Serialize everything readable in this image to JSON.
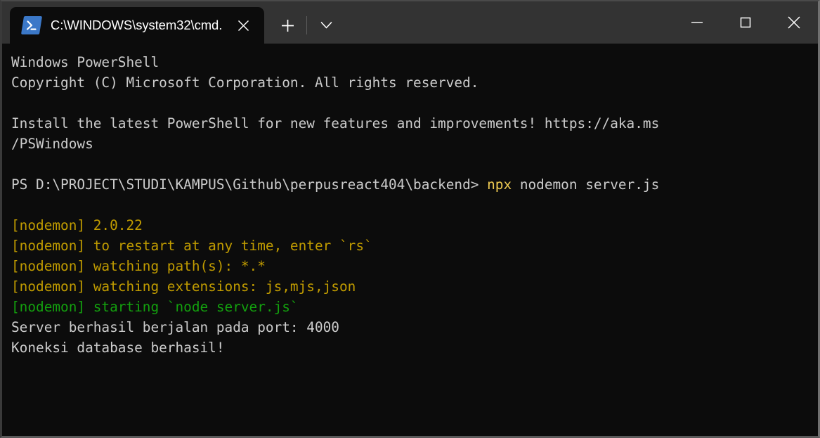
{
  "window": {
    "tab": {
      "title": "C:\\WINDOWS\\system32\\cmd.",
      "icon": "powershell-icon",
      "close_label": "✕"
    },
    "toolbar": {
      "new_tab_label": "+",
      "dropdown_label": "⌄"
    },
    "controls": {
      "minimize_label": "—",
      "maximize_label": "□",
      "close_label": "✕"
    }
  },
  "terminal": {
    "colors": {
      "background": "#0c0c0c",
      "foreground": "#cccccc",
      "yellow": "#c19c00",
      "bright_yellow": "#eeca52",
      "green": "#13a10e",
      "titlebar": "#333333",
      "accent_blue": "#3b78c8"
    },
    "lines": [
      {
        "id": "l1",
        "segments": [
          {
            "text": "Windows PowerShell",
            "color": "white"
          }
        ]
      },
      {
        "id": "l2",
        "segments": [
          {
            "text": "Copyright (C) Microsoft Corporation. All rights reserved.",
            "color": "white"
          }
        ]
      },
      {
        "id": "l3",
        "segments": [
          {
            "text": "",
            "color": "white"
          }
        ]
      },
      {
        "id": "l4",
        "segments": [
          {
            "text": "Install the latest PowerShell for new features and improvements! https://aka.ms",
            "color": "white"
          }
        ]
      },
      {
        "id": "l5",
        "segments": [
          {
            "text": "/PSWindows",
            "color": "white"
          }
        ]
      },
      {
        "id": "l6",
        "segments": [
          {
            "text": "",
            "color": "white"
          }
        ]
      },
      {
        "id": "l7",
        "segments": [
          {
            "text": "PS D:\\PROJECT\\STUDI\\KAMPUS\\Github\\perpusreact404\\backend> ",
            "color": "white"
          },
          {
            "text": "npx",
            "color": "gold"
          },
          {
            "text": " nodemon server.js",
            "color": "white"
          }
        ]
      },
      {
        "id": "l8",
        "segments": [
          {
            "text": "",
            "color": "white"
          }
        ]
      },
      {
        "id": "l9",
        "segments": [
          {
            "text": "[nodemon] 2.0.22",
            "color": "yellow"
          }
        ]
      },
      {
        "id": "l10",
        "segments": [
          {
            "text": "[nodemon] to restart at any time, enter `rs`",
            "color": "yellow"
          }
        ]
      },
      {
        "id": "l11",
        "segments": [
          {
            "text": "[nodemon] watching path(s): *.*",
            "color": "yellow"
          }
        ]
      },
      {
        "id": "l12",
        "segments": [
          {
            "text": "[nodemon] watching extensions: js,mjs,json",
            "color": "yellow"
          }
        ]
      },
      {
        "id": "l13",
        "segments": [
          {
            "text": "[nodemon] starting `node server.js`",
            "color": "green"
          }
        ]
      },
      {
        "id": "l14",
        "segments": [
          {
            "text": "Server berhasil berjalan pada port: 4000",
            "color": "white"
          }
        ]
      },
      {
        "id": "l15",
        "segments": [
          {
            "text": "Koneksi database berhasil!",
            "color": "white"
          }
        ]
      }
    ]
  }
}
